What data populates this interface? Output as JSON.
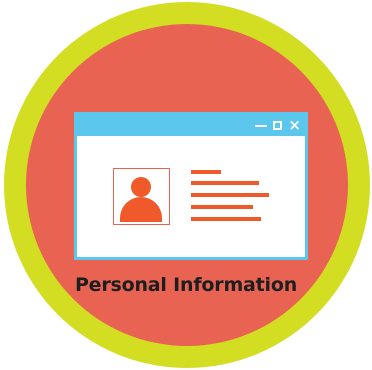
{
  "badge": {
    "label": "Personal Information",
    "icon": "id-card-window-icon",
    "colors": {
      "outer_ring": "#d3de22",
      "inner_circle": "#e96353",
      "window_frame": "#5bc7ec",
      "accent": "#f05a2a"
    }
  },
  "window": {
    "controls": {
      "minimize": "minimize-icon",
      "maximize": "maximize-icon",
      "close": "×"
    }
  }
}
